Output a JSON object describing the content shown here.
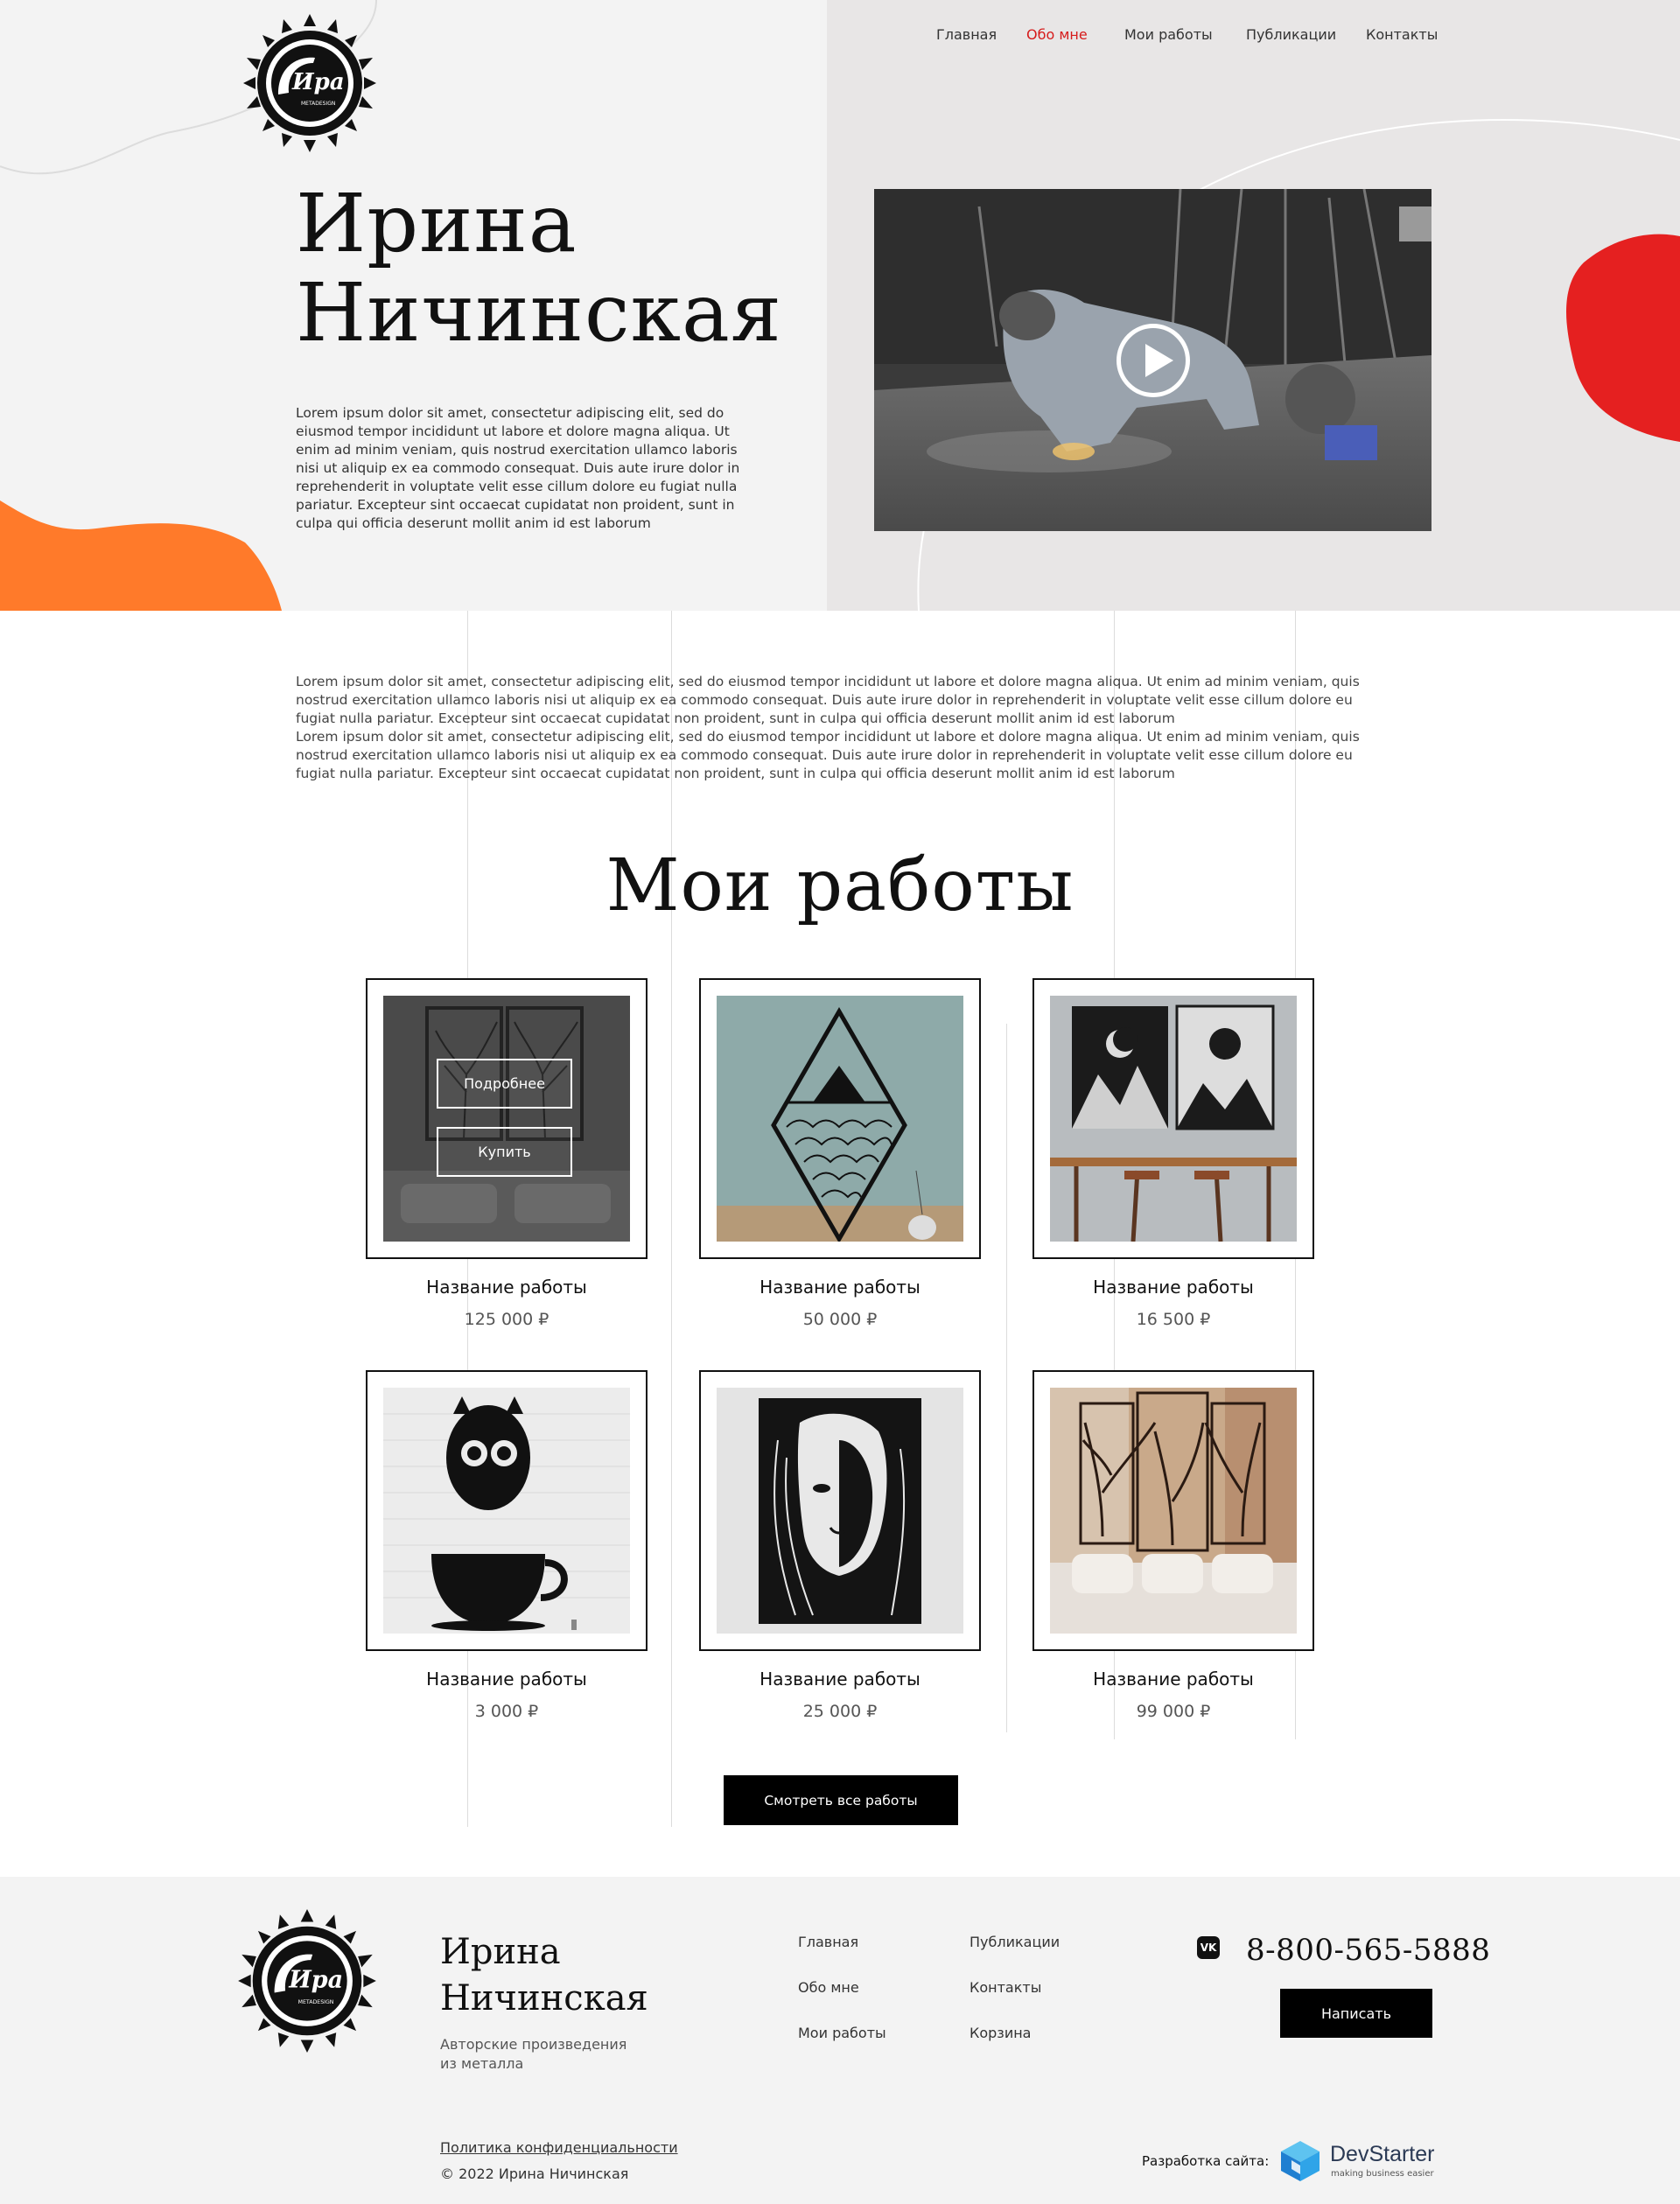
{
  "colors": {
    "accent_red": "#d61b1b",
    "blob_red": "#e52020",
    "blob_orange": "#ff7a2a",
    "dark_button": "#000000",
    "hero_left_bg": "#f3f3f3",
    "hero_right_bg": "#e8e6e6"
  },
  "header": {
    "logo_icon": "sun-logo-icon",
    "nav": [
      {
        "label": "Главная",
        "active": false
      },
      {
        "label": "Обо мне",
        "active": true
      },
      {
        "label": "Мои работы",
        "active": false
      },
      {
        "label": "Публикации",
        "active": false
      },
      {
        "label": "Контакты",
        "active": false
      }
    ]
  },
  "hero": {
    "title_line1": "Ирина",
    "title_line2": "Ничинская",
    "text": "Lorem ipsum dolor sit amet, consectetur adipiscing elit, sed do eiusmod tempor incididunt ut labore et dolore magna aliqua. Ut enim ad minim veniam, quis nostrud exercitation ullamco laboris nisi ut aliquip ex ea commodo consequat. Duis aute irure dolor in reprehenderit in voluptate velit esse cillum dolore eu fugiat nulla pariatur. Excepteur sint occaecat cupidatat non proident, sunt in culpa qui officia deserunt mollit anim id est laborum",
    "video_icon": "play-icon"
  },
  "about": {
    "paragraph1": "Lorem ipsum dolor sit amet, consectetur adipiscing elit, sed do eiusmod tempor incididunt ut labore et dolore magna aliqua. Ut enim ad minim veniam, quis nostrud exercitation ullamco laboris nisi ut aliquip ex ea commodo consequat. Duis aute irure dolor in reprehenderit in voluptate velit esse cillum dolore eu fugiat nulla pariatur. Excepteur sint occaecat cupidatat non proident, sunt in culpa qui officia deserunt mollit anim id est laborum",
    "paragraph2": "Lorem ipsum dolor sit amet, consectetur adipiscing elit, sed do eiusmod tempor incididunt ut labore et dolore magna aliqua. Ut enim ad minim veniam, quis nostrud exercitation ullamco laboris nisi ut aliquip ex ea commodo consequat. Duis aute irure dolor in reprehenderit in voluptate velit esse cillum dolore eu fugiat nulla pariatur. Excepteur sint occaecat cupidatat non proident, sunt in culpa qui officia deserunt mollit anim id est laborum"
  },
  "works": {
    "title": "Мои работы",
    "details_label": "Подробнее",
    "buy_label": "Купить",
    "items": [
      {
        "name": "Название работы",
        "price": "125 000 ₽"
      },
      {
        "name": "Название работы",
        "price": "50 000 ₽"
      },
      {
        "name": "Название работы",
        "price": "16 500 ₽"
      },
      {
        "name": "Название работы",
        "price": "3 000 ₽"
      },
      {
        "name": "Название работы",
        "price": "25 000 ₽"
      },
      {
        "name": "Название работы",
        "price": "99 000 ₽"
      }
    ],
    "all_label": "Смотреть все работы"
  },
  "footer": {
    "name_line1": "Ирина",
    "name_line2": "Ничинская",
    "subtitle": "Авторские произведения из металла",
    "links_col1": [
      "Главная",
      "Обо мне",
      "Мои работы"
    ],
    "links_col2": [
      "Публикации",
      "Контакты",
      "Корзина"
    ],
    "vk_icon": "vk-icon",
    "vk_label": "VK",
    "phone": "8-800-565-5888",
    "write_label": "Написать",
    "policy": "Политика конфиденциальности",
    "copyright": "© 2022 Ирина Ничинская",
    "dev_label": "Разработка сайта:",
    "dev_name": "DevStarter",
    "dev_tagline": "making business easier"
  }
}
